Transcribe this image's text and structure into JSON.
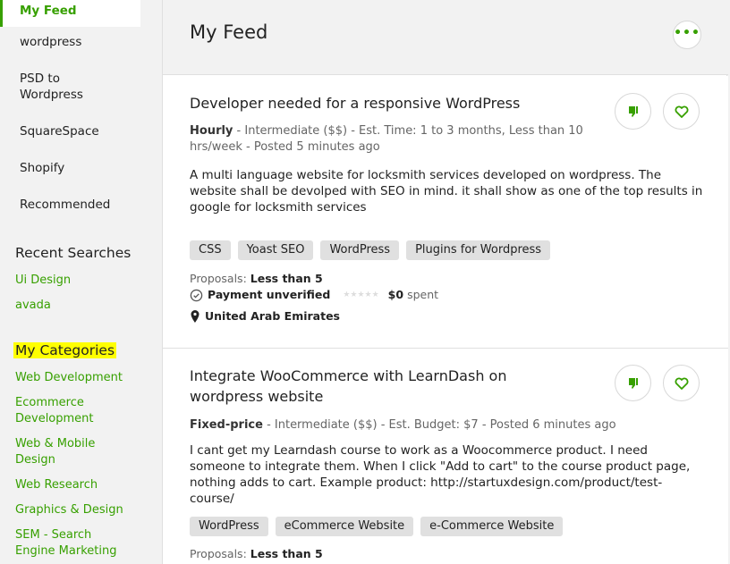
{
  "sidebar": {
    "feeds": [
      "My Feed",
      "wordpress",
      "PSD to Wordpress",
      "SquareSpace",
      "Shopify",
      "Recommended"
    ],
    "recent_heading": "Recent Searches",
    "recent": [
      "Ui Design",
      "avada"
    ],
    "categories_heading": "My Categories",
    "categories": [
      "Web Development",
      "Ecommerce Development",
      "Web & Mobile Design",
      "Web Research",
      "Graphics & Design",
      "SEM - Search Engine Marketing"
    ]
  },
  "header": {
    "title": "My Feed",
    "more_icon": "more-dots-icon"
  },
  "jobs": [
    {
      "title": "Developer needed for a responsive WordPress",
      "type": "Hourly",
      "meta_rest": " - Intermediate ($$) - Est. Time: 1 to 3 months, Less than 10 hrs/week - Posted 5 minutes ago",
      "description": "A multi language website for locksmith services developed on wordpress. The website shall be devolped with SEO in mind. it shall show as one of the top results in google for locksmith services",
      "tags": [
        "CSS",
        "Yoast SEO",
        "WordPress",
        "Plugins for Wordpress"
      ],
      "proposals_label": "Proposals:",
      "proposals": "Less than 5",
      "payment": "Payment unverified",
      "spent_amount": "$0",
      "spent_label": "spent",
      "location": "United Arab Emirates"
    },
    {
      "title": "Integrate WooCommerce with LearnDash on wordpress website",
      "type": "Fixed-price",
      "meta_rest": " - Intermediate ($$) - Est. Budget: $7 - Posted 6 minutes ago",
      "description": "I cant get my Learndash course to work as a Woocommerce product. I need someone to integrate them. When I click \"Add to cart\" to the course product page, nothing adds to cart. Example product: http://startuxdesign.com/product/test-course/",
      "tags": [
        "WordPress",
        "eCommerce Website",
        "e-Commerce Website"
      ],
      "proposals_label": "Proposals:",
      "proposals": "Less than 5"
    }
  ],
  "colors": {
    "accent": "#37a000",
    "highlight": "#ffff00"
  }
}
